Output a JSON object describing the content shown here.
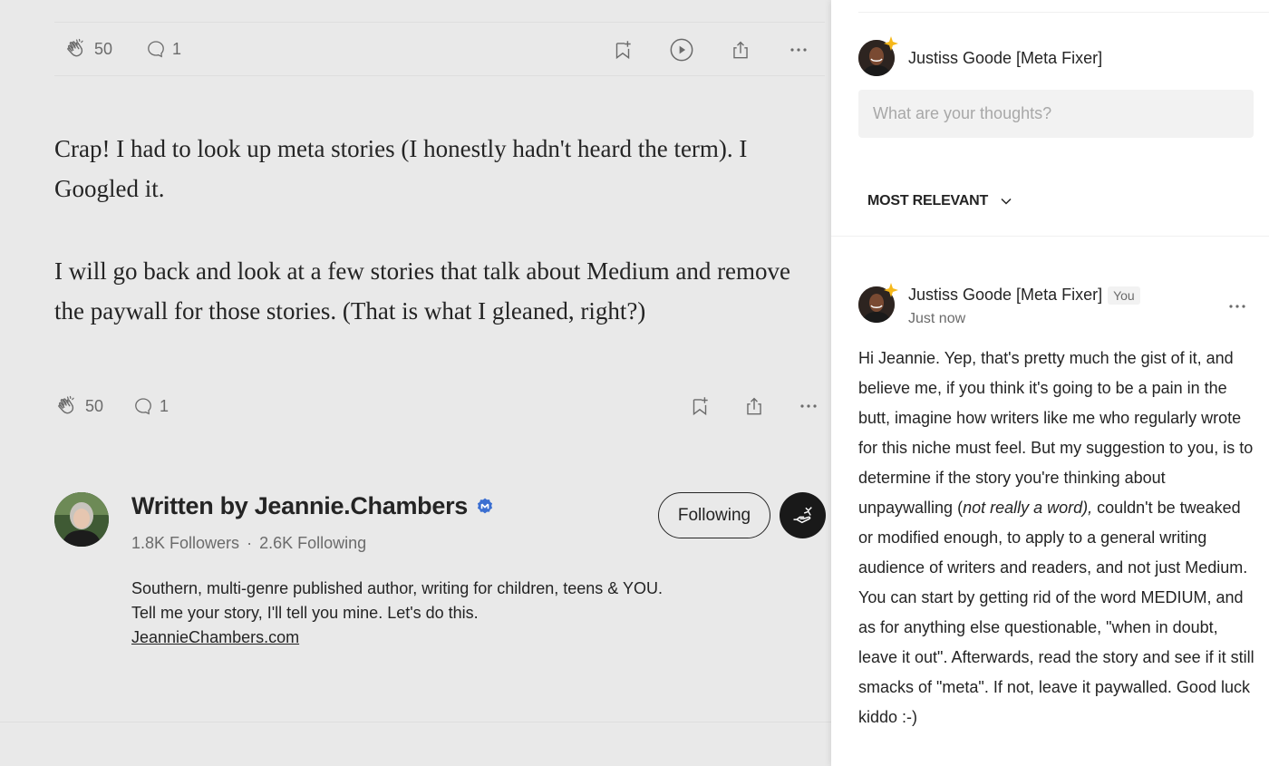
{
  "article": {
    "top_actions": {
      "claps": "50",
      "responses": "1"
    },
    "paragraphs": [
      "Crap! I had to look up meta stories (I honestly hadn't heard the term). I Googled it.",
      "I will go back and look at a few stories that talk about Medium and remove the paywall for those stories. (That is what I gleaned, right?)"
    ],
    "bottom_actions": {
      "claps": "50",
      "responses": "1"
    }
  },
  "author": {
    "written_by": "Written by Jeannie.Chambers",
    "followers": "1.8K Followers",
    "separator": "·",
    "following": "2.6K Following",
    "bio": "Southern, multi-genre published author, writing for children, teens & YOU. Tell me your story, I'll tell you mine. Let's do this.",
    "link": "JeannieChambers.com",
    "follow_button": "Following"
  },
  "responses": {
    "current_user": "Justiss Goode [Meta Fixer]",
    "input_placeholder": "What are your thoughts?",
    "sort_label": "MOST RELEVANT",
    "comment": {
      "author": "Justiss Goode [Meta Fixer]",
      "badge": "You",
      "time": "Just now",
      "text_before_italic": "Hi Jeannie. Yep, that's pretty much the gist of it, and believe me, if you think it's going to be a pain in the butt, imagine how writers like me who regularly wrote for this niche must feel. But my suggestion to you, is to determine if the story you're thinking about unpaywalling (",
      "text_italic": "not really a word),",
      "text_after_italic": " couldn't be tweaked or modified enough, to apply to a general writing audience of writers and readers, and not just Medium. You can start by getting rid of the word MEDIUM, and as for anything else questionable, \"when in doubt, leave it out\". Afterwards, read the story and see if it still smacks of \"meta\". If not, leave it paywalled. Good luck kiddo :-)"
    }
  },
  "colors": {
    "text": "#242424",
    "muted": "#6b6b6b",
    "verified": "#3b6fd1",
    "panel_bg": "#ffffff",
    "page_bg": "#e9e9e9"
  }
}
